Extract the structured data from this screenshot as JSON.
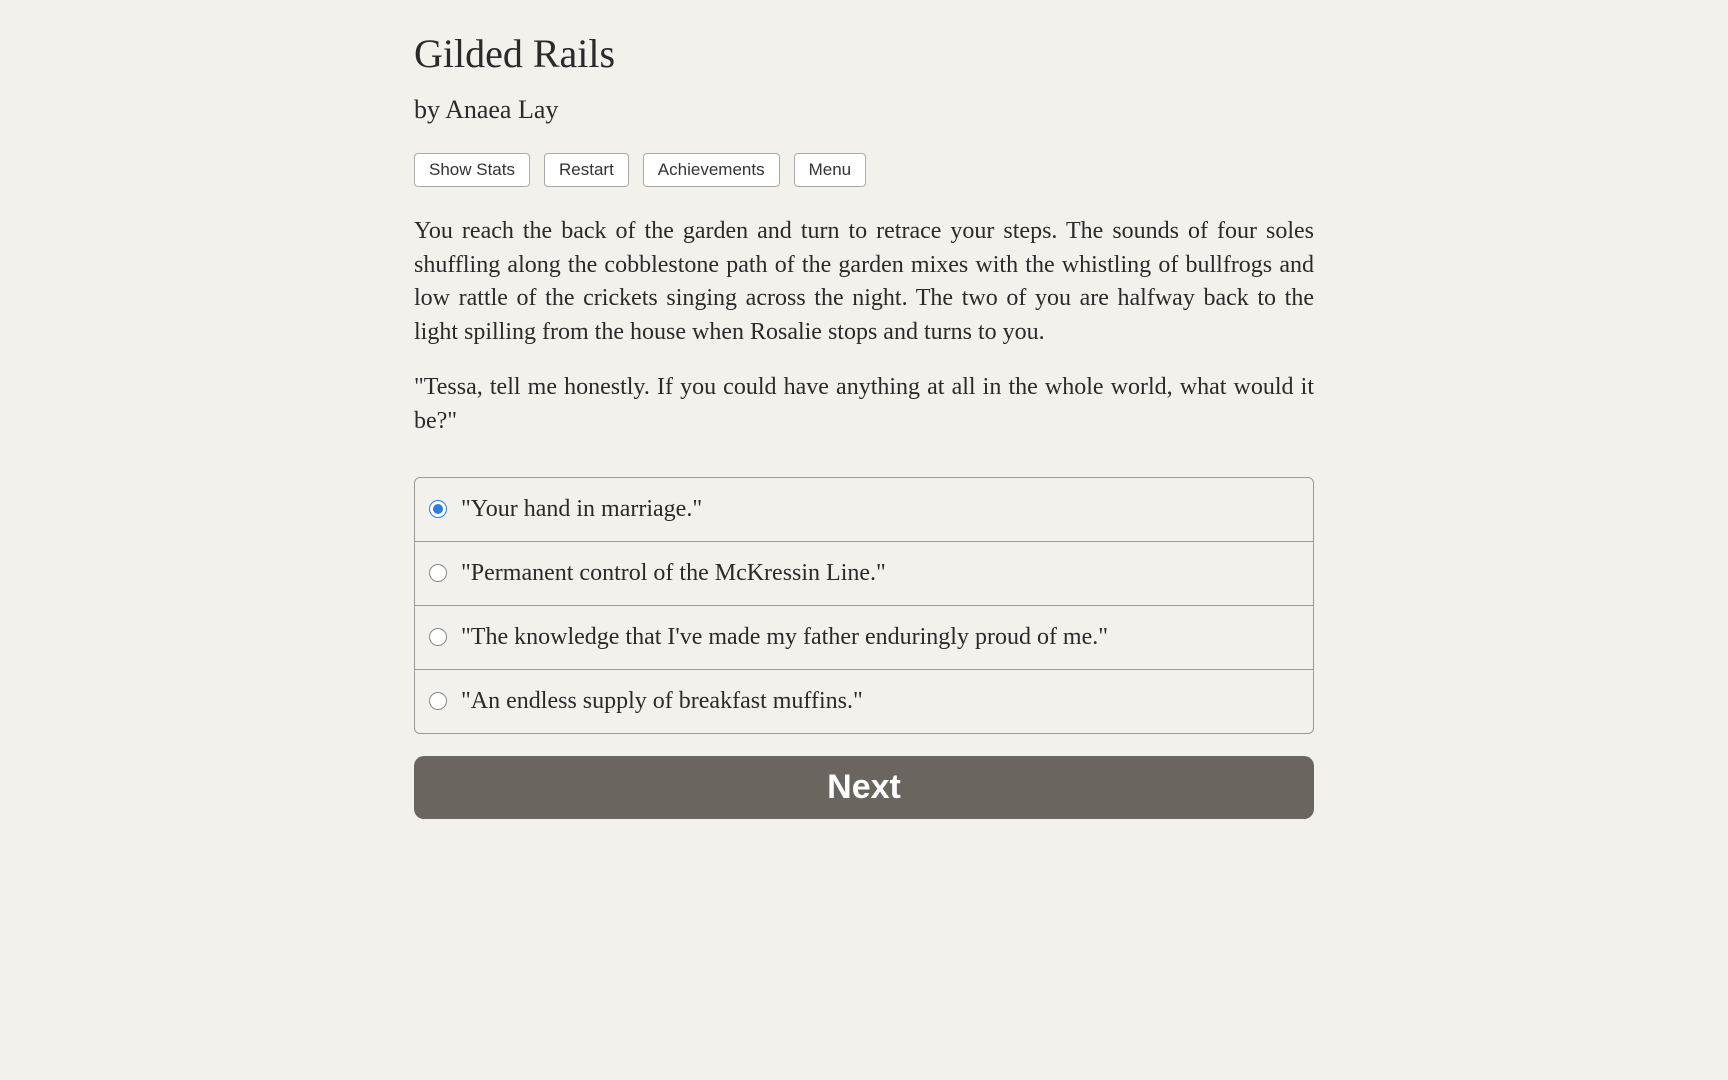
{
  "title": "Gilded Rails",
  "author": "by Anaea Lay",
  "toolbar": {
    "show_stats": "Show Stats",
    "restart": "Restart",
    "achievements": "Achievements",
    "menu": "Menu"
  },
  "story": {
    "paragraph1": "You reach the back of the garden and turn to retrace your steps. The sounds of four soles shuffling along the cobblestone path of the garden mixes with the whistling of bullfrogs and low rattle of the crickets singing across the night. The two of you are halfway back to the light spilling from the house when Rosalie stops and turns to you.",
    "paragraph2": "\"Tessa, tell me honestly. If you could have anything at all in the whole world, what would it be?\""
  },
  "choices": [
    {
      "label": "\"Your hand in marriage.\"",
      "selected": true
    },
    {
      "label": "\"Permanent control of the McKressin Line.\"",
      "selected": false
    },
    {
      "label": "\"The knowledge that I've made my father enduringly proud of me.\"",
      "selected": false
    },
    {
      "label": "\"An endless supply of breakfast muffins.\"",
      "selected": false
    }
  ],
  "next_button": "Next"
}
